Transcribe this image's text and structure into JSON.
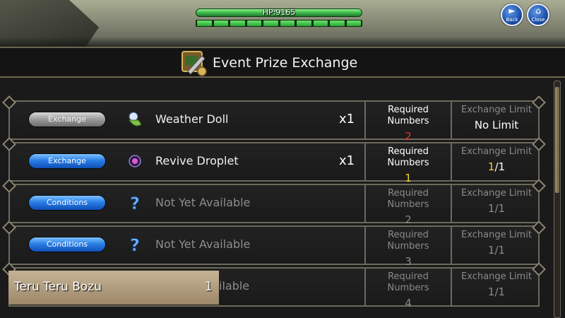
{
  "hud": {
    "hp_label": "HP:9165",
    "hp_segments": 10,
    "back_label": "Back",
    "close_label": "Close"
  },
  "header": {
    "title": "Event Prize Exchange",
    "icon": "prize-exchange-icon"
  },
  "rows": [
    {
      "button": "Exchange",
      "button_state": "disabled",
      "icon": "weather-doll-icon",
      "name": "Weather Doll",
      "qty": "x1",
      "req_header": "Required Numbers",
      "req_value": "2",
      "req_color": "#e03a3a",
      "limit_header": "Exchange Limit",
      "limit_value": "No Limit"
    },
    {
      "button": "Exchange",
      "button_state": "active",
      "icon": "revive-droplet-icon",
      "name": "Revive Droplet",
      "qty": "x1",
      "req_header": "Required Numbers",
      "req_value": "1",
      "req_color": "#f2d630",
      "limit_header": "Exchange Limit",
      "limit_current": "1",
      "limit_max": "/1"
    },
    {
      "button": "Conditions",
      "icon": "question-mark-icon",
      "name": "Not Yet Available",
      "req_header": "Required Numbers",
      "req_value": "2",
      "limit_header": "Exchange Limit",
      "limit_value": "1/1"
    },
    {
      "button": "Conditions",
      "icon": "question-mark-icon",
      "name": "Not Yet Available",
      "req_header": "Required Numbers",
      "req_value": "3",
      "limit_header": "Exchange Limit",
      "limit_value": "1/1"
    },
    {
      "name_partial": "ilable",
      "req_header": "Required Numbers",
      "req_value": "4",
      "limit_header": "Exchange Limit",
      "limit_value": "1/1"
    }
  ],
  "tooltip": {
    "name": "Teru Teru Bozu",
    "qty": "1"
  },
  "colors": {
    "hp_green": "#3fb94c",
    "button_blue": "#2a7ee6",
    "frame": "#6c6a5c",
    "highlight_yellow": "#f2d630",
    "alert_red": "#e03a3a"
  }
}
